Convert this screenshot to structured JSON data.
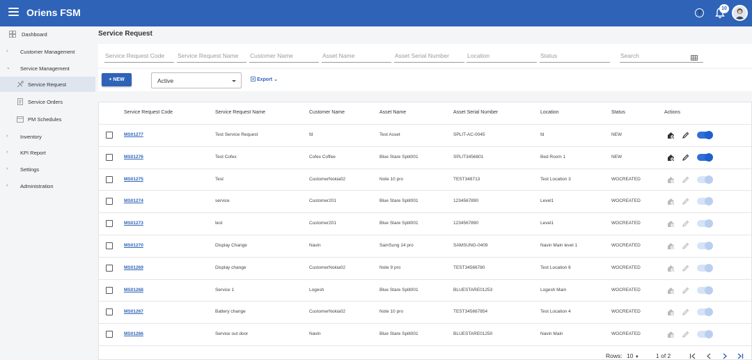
{
  "app": {
    "title": "Oriens FSM",
    "notification_count": "10"
  },
  "sidebar": {
    "items": [
      {
        "label": "Dashboard",
        "type": "icon"
      },
      {
        "label": "Customer Management",
        "type": "group"
      },
      {
        "label": "Service Management",
        "type": "group-open"
      },
      {
        "label": "Service Request",
        "type": "icon",
        "active": true
      },
      {
        "label": "Service Orders",
        "type": "icon"
      },
      {
        "label": "PM Schedules",
        "type": "icon"
      },
      {
        "label": "Inventory",
        "type": "group"
      },
      {
        "label": "KPI Report",
        "type": "group"
      },
      {
        "label": "Settings",
        "type": "group"
      },
      {
        "label": "Administration",
        "type": "group"
      }
    ]
  },
  "page": {
    "title": "Service Request"
  },
  "filters": {
    "code": "Service Request Code",
    "name": "Service Request Name",
    "customer": "Customer Name",
    "asset": "Asset Name",
    "serial": "Asset Serial Number",
    "location": "Location",
    "status": "Status",
    "search": "Search"
  },
  "toolbar": {
    "new_label": "+ NEW",
    "status_value": "Active",
    "export_label": "Export"
  },
  "table": {
    "headers": [
      "Service Request Code",
      "Service Request Name",
      "Customer Name",
      "Asset Name",
      "Asset Serial Number",
      "Location",
      "Status",
      "Actions"
    ],
    "rows": [
      {
        "code": "MS01277",
        "name": "Test Service Request",
        "customer": "fd",
        "asset": "Test Asset",
        "serial": "SPLIT-AC-0045",
        "location": "fd",
        "status": "NEW",
        "enabled": true
      },
      {
        "code": "MS01276",
        "name": "Test Cofex",
        "customer": "Cofex Coffee",
        "asset": "Blue Stare Split001",
        "serial": "SPLIT3456801",
        "location": "Bed Room 1",
        "status": "NEW",
        "enabled": true
      },
      {
        "code": "MS01275",
        "name": "Test",
        "customer": "CustomerNokia02",
        "asset": "Note 10 pro",
        "serial": "TEST348713",
        "location": "Test Location 3",
        "status": "WOCREATED",
        "enabled": false
      },
      {
        "code": "MS01274",
        "name": "service",
        "customer": "Customer201",
        "asset": "Blue Stare Split001",
        "serial": "1234567890",
        "location": "Level1",
        "status": "WOCREATED",
        "enabled": false
      },
      {
        "code": "MS01273",
        "name": "test",
        "customer": "Customer201",
        "asset": "Blue Stare Split001",
        "serial": "1234567890",
        "location": "Level1",
        "status": "WOCREATED",
        "enabled": false
      },
      {
        "code": "MS01270",
        "name": "Display Change",
        "customer": "Navin",
        "asset": "SamSung 14 pro",
        "serial": "SAMSUNG-0409",
        "location": "Navin Main level 1",
        "status": "WOCREATED",
        "enabled": false
      },
      {
        "code": "MS01269",
        "name": "Display change",
        "customer": "CustomerNokia02",
        "asset": "Note 9 pro",
        "serial": "TEST34566780",
        "location": "Test Location 6",
        "status": "WOCREATED",
        "enabled": false
      },
      {
        "code": "MS01268",
        "name": "Service 1",
        "customer": "Logesh",
        "asset": "Blue Stare Split001",
        "serial": "BLUESTARE01253",
        "location": "Logesh Main",
        "status": "WOCREATED",
        "enabled": false
      },
      {
        "code": "MS01267",
        "name": "Battery change",
        "customer": "CustomerNokia02",
        "asset": "Note 10 pro",
        "serial": "TEST345667854",
        "location": "Test Location 4",
        "status": "WOCREATED",
        "enabled": false
      },
      {
        "code": "MS01266",
        "name": "Service out door",
        "customer": "Navin",
        "asset": "Blue Stare Split001",
        "serial": "BLUESTARE01250",
        "location": "Navin Main",
        "status": "WOCREATED",
        "enabled": false
      }
    ]
  },
  "pagination": {
    "rows_label": "Rows:",
    "rows_value": "10",
    "page_info": "1 of 2"
  },
  "colors": {
    "brand": "#2e63b8",
    "toggle_on": "#2f6fd6",
    "toggle_off": "#b9cff0"
  }
}
